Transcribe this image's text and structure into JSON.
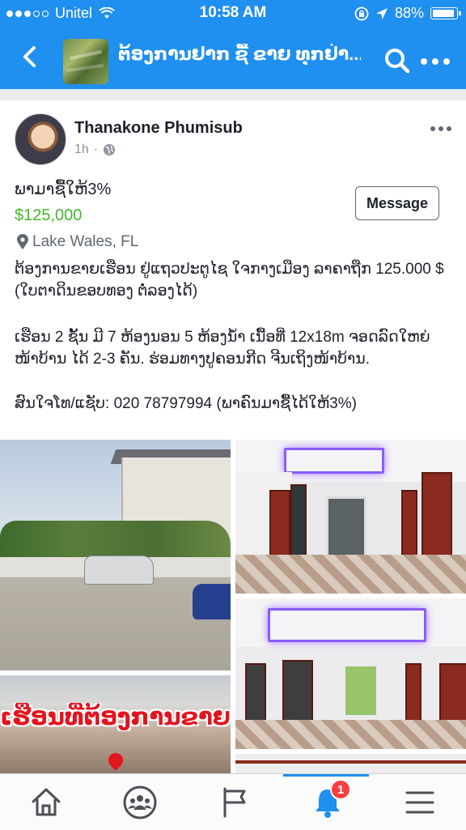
{
  "status_bar": {
    "carrier": "Unitel",
    "time": "10:58 AM",
    "battery": "88%",
    "signal_bars_filled": 3,
    "signal_bars_total": 5
  },
  "nav": {
    "group_title": "ຕ້ອງການຢາກ ຊື້ ຂາຍ ທຸກຢ່າ...",
    "icons": [
      "back-chevron-icon",
      "search-icon",
      "more-icon"
    ],
    "accent_color": "#1f8ff0"
  },
  "post": {
    "author": "Thanakone Phumisub",
    "time": "1h",
    "item_title": "ພາມາຊື້ໃຫ້3%",
    "price": "$125,000",
    "location": "Lake Wales, FL",
    "message_button": "Message",
    "paragraph1": "ຕ້ອງການຂາຍເຮືອນ ຢູ່ແຖວປະຕູໄຊ ໃຈກາງເມືອງ ລາຄາຖືກ 125.000 $ (ໃບຕາດິນຂອບທອງ ຕໍ່ລອງໄດ້)",
    "paragraph2": "ເຮືອນ 2 ຊັ້ນ ມີ 7 ຫ້ອງນອນ 5 ຫ້ອງນ້ໍາ ເນື້ອທີ່ 12x18m ຈອດລົດໃຫຍ່ໜ້າບ້ານ ໄດ້ 2-3 ຄັນ. ຮ່ອມທາງປູຄອນກີດ ຈີນເຖິງໜ້າບ້ານ.",
    "paragraph3": "ສົນໃຈໂທ/ແຊັບ: 020 78797994 (ພາຄົນມາຊື້ໄດ້ໃຫ້3%)",
    "photo_banner_text": "ເຮືອນທີ່ຕ້ອງການຂາຍ",
    "price_color": "#42b72a"
  },
  "tab_bar": {
    "tabs": [
      "home-icon",
      "groups-icon",
      "pages-flag-icon",
      "notifications-bell-icon",
      "menu-icon"
    ],
    "notification_count": "1",
    "active_tab": "notifications-bell-icon"
  }
}
